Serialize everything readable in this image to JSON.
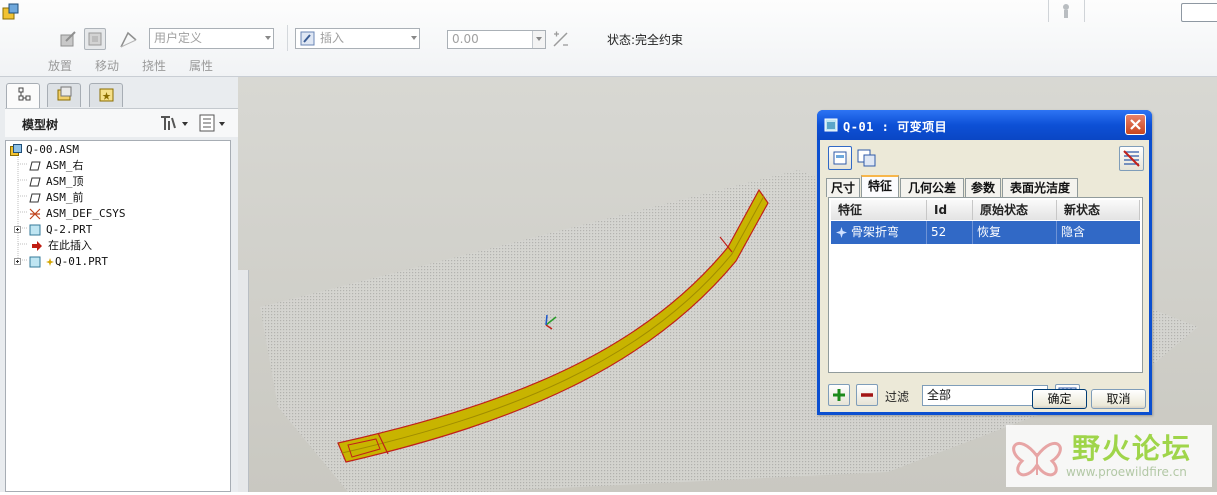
{
  "toolbar": {
    "place_label": "放置",
    "move_label": "移动",
    "flex_label": "挠性",
    "props_label": "属性",
    "constraint_type": "用户定义",
    "insert_mode": "插入",
    "offset_value": "0.00",
    "status_text": "状态:完全约束"
  },
  "model_tree": {
    "title": "模型树",
    "items": [
      {
        "label": "Q-00.ASM"
      },
      {
        "label": "ASM_右"
      },
      {
        "label": "ASM_顶"
      },
      {
        "label": "ASM_前"
      },
      {
        "label": "ASM_DEF_CSYS"
      },
      {
        "label": "Q-2.PRT"
      },
      {
        "label": "在此插入"
      },
      {
        "label": "Q-01.PRT"
      }
    ]
  },
  "dialog": {
    "title": "Q-01 : 可变项目",
    "tabs": [
      "尺寸",
      "特征",
      "几何公差",
      "参数",
      "表面光洁度"
    ],
    "active_tab": "特征",
    "columns": [
      "特征",
      "Id",
      "原始状态",
      "新状态"
    ],
    "rows": [
      {
        "feature": "骨架折弯",
        "id": "52",
        "original": "恢复",
        "new": "隐含"
      }
    ],
    "filter_label": "过滤",
    "filter_value": "全部",
    "ok_label": "确定",
    "cancel_label": "取消"
  },
  "watermark": {
    "brand": "野火论坛",
    "url": "www.proewildfire.cn"
  },
  "colors": {
    "selection": "#3169c6",
    "titlebar": "#0d50d6",
    "model_yellow": "#c8b400",
    "model_edge": "#c0201a",
    "tab_highlight": "#f7b64b"
  }
}
